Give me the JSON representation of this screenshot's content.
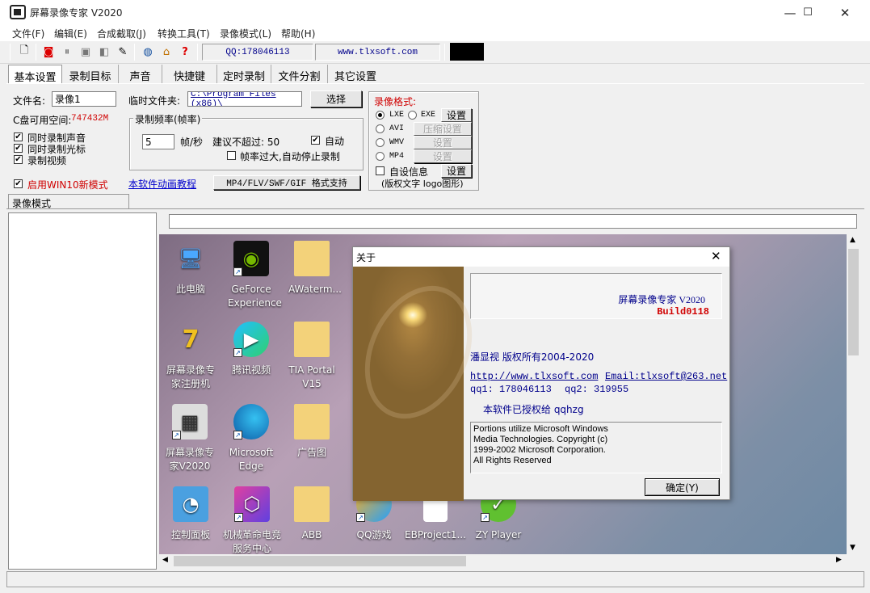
{
  "window": {
    "title": "屏幕录像专家 V2020",
    "min": "—",
    "max": "☐",
    "close": "✕"
  },
  "menu": [
    "文件(F)",
    "编辑(E)",
    "合成截取(J)",
    "转换工具(T)",
    "录像模式(L)",
    "帮助(H)"
  ],
  "toolbar": {
    "qq": "QQ:178046113",
    "site": "www.tlxsoft.com"
  },
  "tabs": [
    "基本设置",
    "录制目标",
    "声音",
    "快捷键",
    "定时录制",
    "文件分割",
    "其它设置"
  ],
  "basic": {
    "filename_label": "文件名:",
    "filename_value": "录像1",
    "temp_label": "临时文件夹:",
    "temp_value": "C:\\Program Files (x86)\\",
    "choose_btn": "选择",
    "disk_label": "C盘可用空间:",
    "disk_value": "747432M",
    "checks": [
      {
        "label": "同时录制声音",
        "checked": true
      },
      {
        "label": "同时录制光标",
        "checked": true
      },
      {
        "label": "录制视频",
        "checked": true
      }
    ],
    "win10_label": "启用WIN10新模式",
    "win10_checked": true,
    "fps_group": "录制频率(帧率)",
    "fps_value": "5",
    "fps_unit": "帧/秒",
    "fps_suggest": "建议不超过: 50",
    "auto_label": "自动",
    "auto_checked": true,
    "autostop_label": "帧率过大,自动停止录制",
    "autostop_checked": false,
    "tutorial_link": "本软件动画教程",
    "support_btn": "MP4/FLV/SWF/GIF  格式支持",
    "format_title": "录像格式:",
    "formats": [
      {
        "name": "LXE",
        "selected": true
      },
      {
        "name": "EXE",
        "selected": false
      },
      {
        "name": "AVI",
        "selected": false
      },
      {
        "name": "WMV",
        "selected": false
      },
      {
        "name": "MP4",
        "selected": false
      }
    ],
    "set_btn": "设置",
    "compress_btn": "压缩设置",
    "custom_info_label": "自设信息",
    "custom_info_checked": false,
    "custom_info_note": "(版权文字 logo图形)"
  },
  "mode_tab": "录像模式",
  "desktop_icons": [
    {
      "name": "此电脑",
      "icon": "computer-icon"
    },
    {
      "name": "GeForce Experience",
      "icon": "nvidia-icon"
    },
    {
      "name": "AWaterm...",
      "icon": "folder-icon"
    },
    {
      "name": "屏幕录像专家注册机",
      "icon": "keygen-icon"
    },
    {
      "name": "腾讯视频",
      "icon": "tencent-video-icon"
    },
    {
      "name": "TIA Portal V15",
      "icon": "folder-icon"
    },
    {
      "name": "屏幕录像专家V2020",
      "icon": "recorder-icon"
    },
    {
      "name": "Microsoft Edge",
      "icon": "edge-icon"
    },
    {
      "name": "广告图",
      "icon": "folder-icon"
    },
    {
      "name": "控制面板",
      "icon": "control-panel-icon"
    },
    {
      "name": "机械革命电竞服务中心",
      "icon": "mechrevo-icon"
    },
    {
      "name": "ABB",
      "icon": "folder-icon"
    },
    {
      "name": "QQ游戏",
      "icon": "qq-game-icon"
    },
    {
      "name": "EBProject1...",
      "icon": "file-icon"
    },
    {
      "name": "ZY Player",
      "icon": "zy-player-icon"
    }
  ],
  "about": {
    "title": "关于",
    "product": "屏幕录像专家  V2020",
    "build": "Build0118",
    "copyright": "潘显视  版权所有2004-2020",
    "website": "http://www.tlxsoft.com",
    "email": "Email:tlxsoft@263.net",
    "qq1": "qq1: 178046113",
    "qq2": "qq2: 319955",
    "licensed": "本软件已授权给  qqhzg",
    "notice": [
      "Portions utilize Microsoft Windows",
      "Media Technologies.  Copyright (c)",
      "1999-2002 Microsoft Corporation.",
      "All Rights Reserved"
    ],
    "ok": "确定(Y)"
  }
}
